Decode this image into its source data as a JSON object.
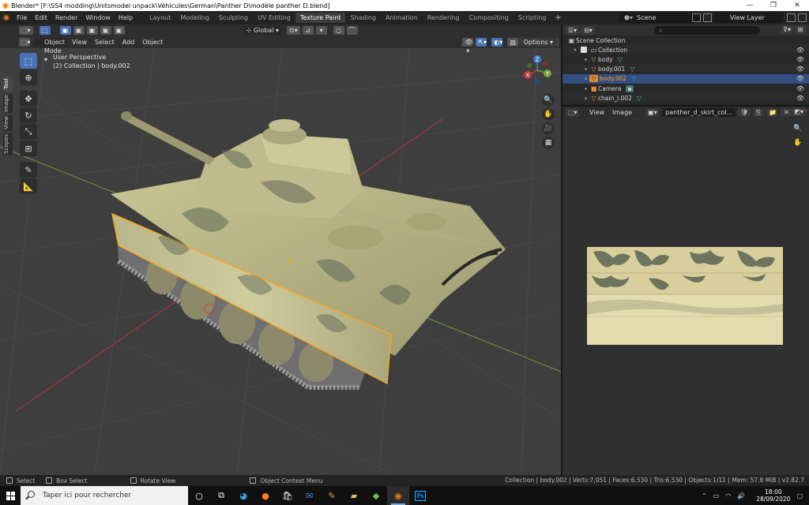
{
  "window": {
    "title": "Blender* [F:\\SS4 modding\\Unitsmodel unpack\\Véhicules\\German\\Panther D\\modèle panther D.blend]"
  },
  "menus": [
    "File",
    "Edit",
    "Render",
    "Window",
    "Help"
  ],
  "workspaces": [
    {
      "label": "Layout",
      "active": false
    },
    {
      "label": "Modeling",
      "active": false
    },
    {
      "label": "Sculpting",
      "active": false
    },
    {
      "label": "UV Editing",
      "active": false
    },
    {
      "label": "Texture Paint",
      "active": true
    },
    {
      "label": "Shading",
      "active": false
    },
    {
      "label": "Animation",
      "active": false
    },
    {
      "label": "Rendering",
      "active": false
    },
    {
      "label": "Compositing",
      "active": false
    },
    {
      "label": "Scripting",
      "active": false
    }
  ],
  "scene": {
    "name": "Scene",
    "view_layer": "View Layer"
  },
  "viewport": {
    "mode": "Object Mode",
    "menus": [
      "View",
      "Select",
      "Add",
      "Object"
    ],
    "transform_orientation": "Global",
    "options_label": "Options",
    "perspective_label": "User Perspective",
    "collection_label": "(2) Collection | body.002",
    "left_tabs": [
      "View",
      "Image",
      "View",
      "Tool"
    ],
    "axis_labels": {
      "x": "X",
      "y": "Y",
      "z": "Z"
    }
  },
  "outliner": {
    "root": "Scene Collection",
    "items": [
      {
        "label": "Collection",
        "type": "collection",
        "selected": false
      },
      {
        "label": "body",
        "type": "mesh",
        "selected": false
      },
      {
        "label": "body.001",
        "type": "mesh",
        "selected": false
      },
      {
        "label": "body.002",
        "type": "mesh",
        "selected": true
      },
      {
        "label": "Camera",
        "type": "camera",
        "selected": false
      },
      {
        "label": "chain_l.002",
        "type": "mesh",
        "selected": false
      }
    ]
  },
  "image_editor": {
    "menus": [
      "View",
      "Image"
    ],
    "image_name": "panther_d_skirt_col..."
  },
  "statusbar": {
    "select": "Select",
    "box_select": "Box Select",
    "rotate_view": "Rotate View",
    "context_menu": "Object Context Menu",
    "stats": "Collection | body.002 | Verts:7,051 | Faces:6,530 | Tris:6,530 | Objects:1/11 | Mem: 57.8 MiB | v2.82.7"
  },
  "taskbar": {
    "search_placeholder": "Taper ici pour rechercher",
    "time": "18:00",
    "date": "28/09/2020"
  },
  "colors": {
    "accent_blue": "#4772b3",
    "blender_orange": "#e87d0d",
    "selection_outline": "#f5a623",
    "x_axis": "#c43c3c",
    "y_axis": "#7aa43c",
    "z_axis": "#3c7ac4",
    "viewport_bg": "#3e3e3e"
  }
}
